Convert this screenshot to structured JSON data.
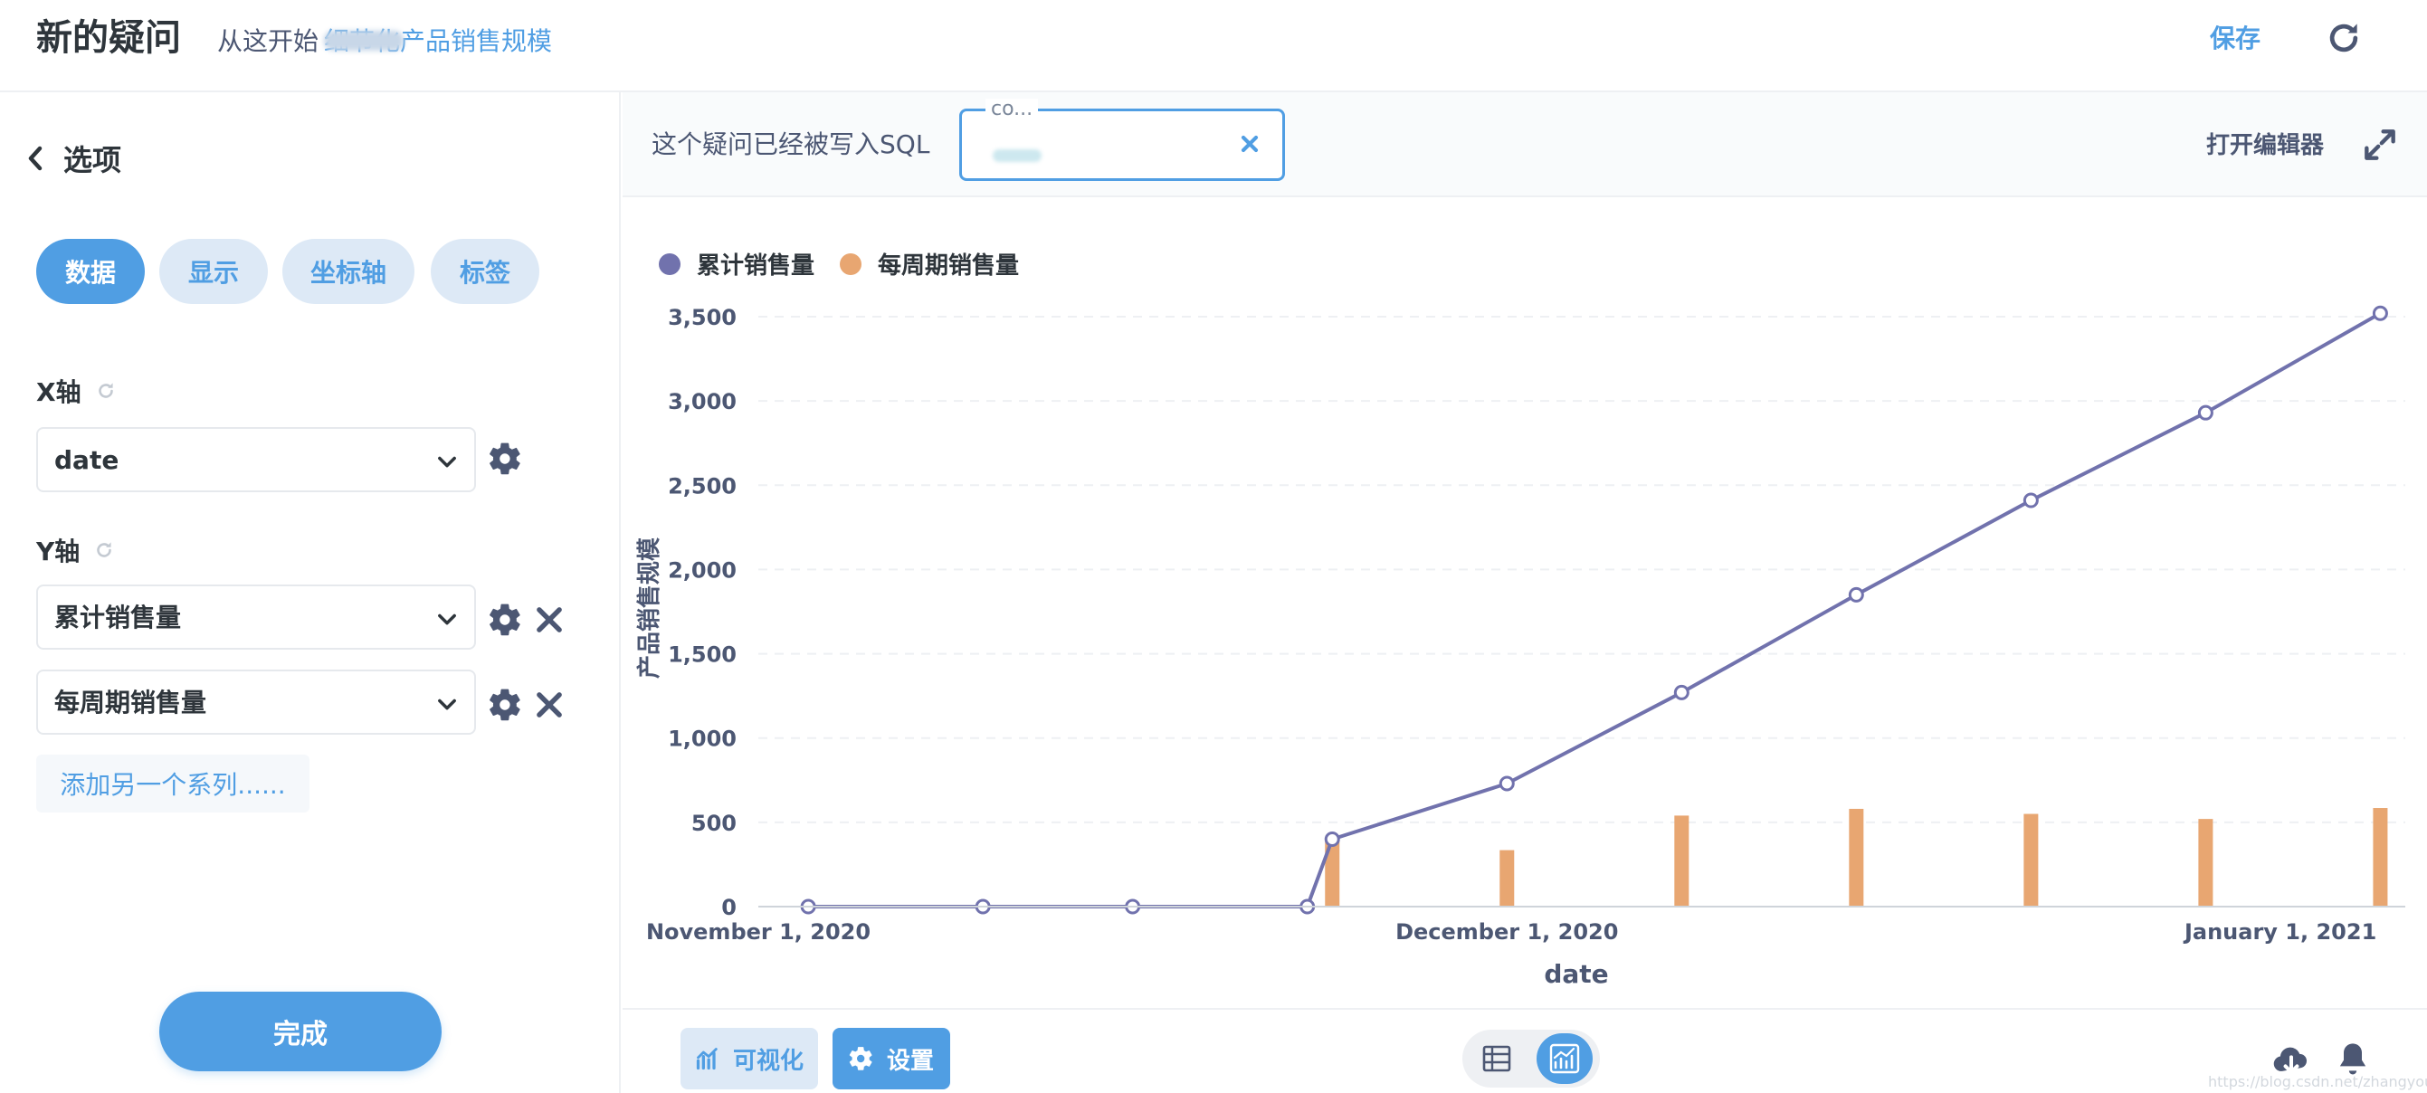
{
  "header": {
    "title": "新的疑问",
    "source_prefix": "从这开始",
    "source_link": "细节化产品销售规模",
    "save_label": "保存"
  },
  "sidebar": {
    "back_label": "选项",
    "tabs": [
      {
        "label": "数据",
        "active": true
      },
      {
        "label": "显示",
        "active": false
      },
      {
        "label": "坐标轴",
        "active": false
      },
      {
        "label": "标签",
        "active": false
      }
    ],
    "x_axis": {
      "label": "X轴",
      "value": "date"
    },
    "y_axis": {
      "label": "Y轴",
      "values": [
        "累计销售量",
        "每周期销售量"
      ]
    },
    "add_series_label": "添加另一个系列......",
    "done_label": "完成"
  },
  "sql_bar": {
    "notice": "这个疑问已经被写入SQL",
    "chip_label": "co...",
    "open_editor_label": "打开编辑器"
  },
  "footer": {
    "visualize_label": "可视化",
    "settings_label": "设置",
    "watermark": "https://blog.csdn.net/zhangyouze"
  },
  "colors": {
    "accent": "#509ee3",
    "series_line": "#7172ad",
    "series_bar": "#e8a671"
  },
  "chart_data": {
    "type": "line",
    "legend_placement": "top-left",
    "series": [
      {
        "name": "累计销售量",
        "type": "line",
        "color": "#7172ad",
        "points": [
          [
            "2020-11-03",
            0
          ],
          [
            "2020-11-10",
            0
          ],
          [
            "2020-11-16",
            0
          ],
          [
            "2020-11-23",
            0
          ],
          [
            "2020-11-24",
            400
          ],
          [
            "2020-12-01",
            730
          ],
          [
            "2020-12-08",
            1270
          ],
          [
            "2020-12-15",
            1850
          ],
          [
            "2020-12-22",
            2410
          ],
          [
            "2020-12-29",
            2930
          ],
          [
            "2021-01-05",
            3520
          ]
        ]
      },
      {
        "name": "每周期销售量",
        "type": "bar",
        "color": "#e8a671",
        "points": [
          [
            "2020-11-24",
            400
          ],
          [
            "2020-12-01",
            335
          ],
          [
            "2020-12-08",
            540
          ],
          [
            "2020-12-15",
            580
          ],
          [
            "2020-12-22",
            550
          ],
          [
            "2020-12-29",
            520
          ],
          [
            "2021-01-05",
            585
          ]
        ]
      }
    ],
    "xlabel": "date",
    "ylabel": "产品销售规模",
    "ylim": [
      0,
      3500
    ],
    "y_ticks": [
      "0",
      "500",
      "1,000",
      "1,500",
      "2,000",
      "2,500",
      "3,000",
      "3,500"
    ],
    "x_ticks": [
      {
        "date": "2020-11-01",
        "label": "November 1, 2020"
      },
      {
        "date": "2020-12-01",
        "label": "December 1, 2020"
      },
      {
        "date": "2021-01-01",
        "label": "January 1, 2021"
      }
    ],
    "x_range": [
      "2020-11-01",
      "2021-01-06"
    ],
    "grid": true
  }
}
